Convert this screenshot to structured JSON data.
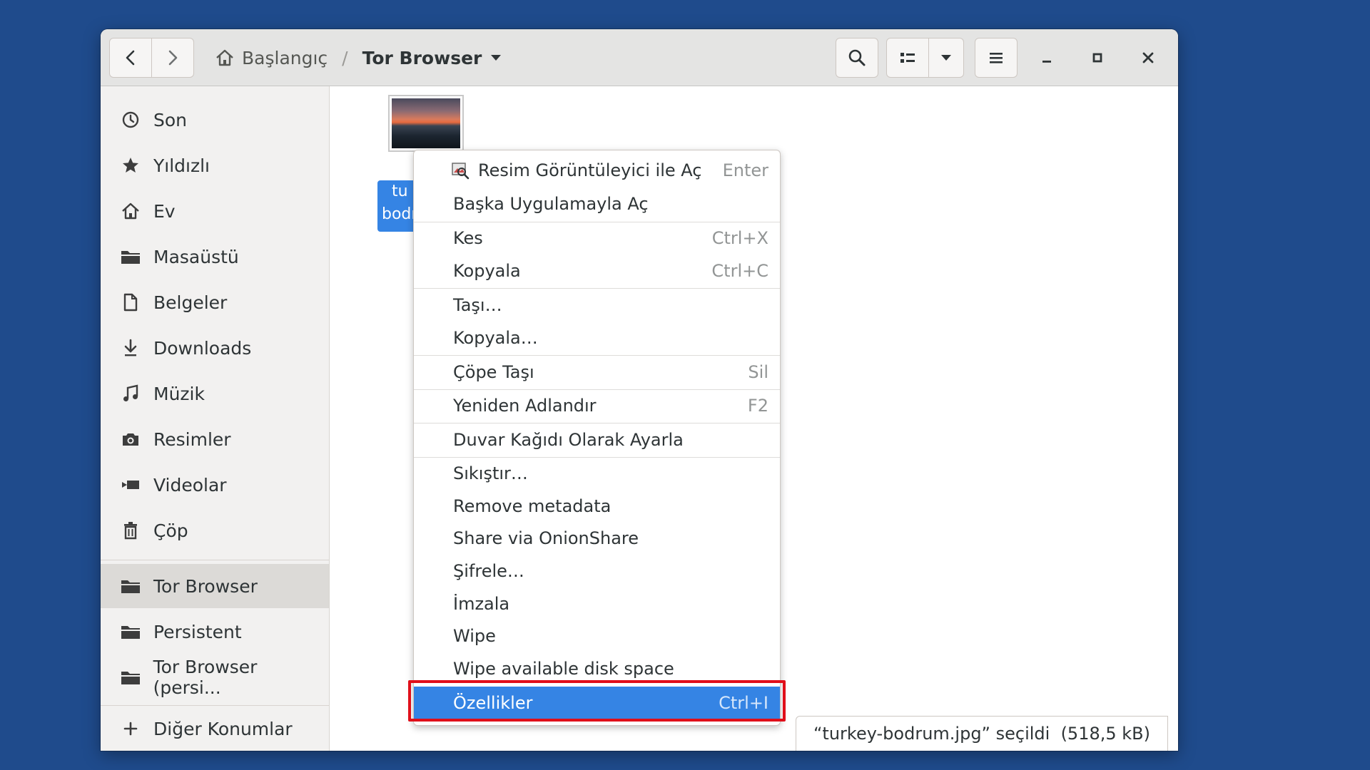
{
  "breadcrumb": {
    "home": "Başlangıç",
    "separator": "/",
    "current": "Tor Browser"
  },
  "sidebar": {
    "items": [
      {
        "label": "Son",
        "icon": "clock-icon"
      },
      {
        "label": "Yıldızlı",
        "icon": "star-icon"
      },
      {
        "label": "Ev",
        "icon": "home-icon"
      },
      {
        "label": "Masaüstü",
        "icon": "folder-icon"
      },
      {
        "label": "Belgeler",
        "icon": "document-icon"
      },
      {
        "label": "Downloads",
        "icon": "download-icon"
      },
      {
        "label": "Müzik",
        "icon": "music-icon"
      },
      {
        "label": "Resimler",
        "icon": "camera-icon"
      },
      {
        "label": "Videolar",
        "icon": "video-icon"
      },
      {
        "label": "Çöp",
        "icon": "trash-icon"
      }
    ],
    "places": [
      {
        "label": "Tor Browser",
        "icon": "folder-icon",
        "active": true
      },
      {
        "label": "Persistent",
        "icon": "folder-icon"
      },
      {
        "label": "Tor Browser (persi...",
        "icon": "folder-icon"
      }
    ],
    "other": {
      "label": "Diğer Konumlar",
      "icon": "plus-icon"
    }
  },
  "file": {
    "label": "turkey-bodrum.jpg",
    "label_visible_1": "tu",
    "label_visible_2": "bodr"
  },
  "context_menu": {
    "items": [
      {
        "label": "Resim Görüntüleyici ile Aç",
        "accel": "Enter"
      },
      {
        "label": "Başka Uygulamayla Aç",
        "accel": ""
      },
      {
        "label": "Kes",
        "accel": "Ctrl+X"
      },
      {
        "label": "Kopyala",
        "accel": "Ctrl+C"
      },
      {
        "label": "Taşı…",
        "accel": ""
      },
      {
        "label": "Kopyala…",
        "accel": ""
      },
      {
        "label": "Çöpe Taşı",
        "accel": "Sil"
      },
      {
        "label": "Yeniden Adlandır",
        "accel": "F2"
      },
      {
        "label": "Duvar Kağıdı Olarak Ayarla",
        "accel": ""
      },
      {
        "label": "Sıkıştır…",
        "accel": ""
      },
      {
        "label": "Remove metadata",
        "accel": ""
      },
      {
        "label": "Share via OnionShare",
        "accel": ""
      },
      {
        "label": "Şifrele…",
        "accel": ""
      },
      {
        "label": "İmzala",
        "accel": ""
      },
      {
        "label": "Wipe",
        "accel": ""
      },
      {
        "label": "Wipe available disk space",
        "accel": ""
      },
      {
        "label": "Özellikler",
        "accel": "Ctrl+I",
        "highlighted": true
      }
    ]
  },
  "status": "“turkey-bodrum.jpg” seçildi  (518,5 kB)",
  "colors": {
    "desktop": "#1f4b8c",
    "accent": "#3584e4",
    "annotation": "#e00f1a"
  }
}
